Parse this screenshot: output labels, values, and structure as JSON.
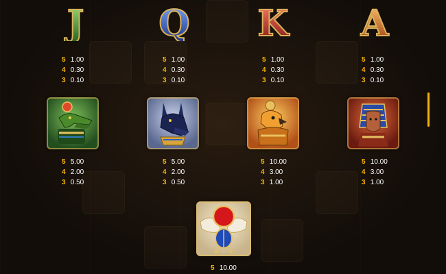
{
  "letters": [
    {
      "symbol": "J",
      "color": "#3f9a3a"
    },
    {
      "symbol": "Q",
      "color": "#2e4fb0"
    },
    {
      "symbol": "K",
      "color": "#c0332a"
    },
    {
      "symbol": "A",
      "color": "#d7701f"
    }
  ],
  "paytable_row1": [
    [
      {
        "count": "5",
        "value": "1.00"
      },
      {
        "count": "4",
        "value": "0.30"
      },
      {
        "count": "3",
        "value": "0.10"
      }
    ],
    [
      {
        "count": "5",
        "value": "1.00"
      },
      {
        "count": "4",
        "value": "0.30"
      },
      {
        "count": "3",
        "value": "0.10"
      }
    ],
    [
      {
        "count": "5",
        "value": "1.00"
      },
      {
        "count": "4",
        "value": "0.30"
      },
      {
        "count": "3",
        "value": "0.10"
      }
    ],
    [
      {
        "count": "5",
        "value": "1.00"
      },
      {
        "count": "4",
        "value": "0.30"
      },
      {
        "count": "3",
        "value": "0.10"
      }
    ]
  ],
  "gods": [
    {
      "icon": "crocodile-god-icon",
      "bg": "#2f6a30"
    },
    {
      "icon": "anubis-icon",
      "bg": "#4a5a8a"
    },
    {
      "icon": "horus-falcon-icon",
      "bg": "#b8581a"
    },
    {
      "icon": "pharaoh-icon",
      "bg": "#9a2e1e"
    }
  ],
  "paytable_row2": [
    [
      {
        "count": "5",
        "value": "5.00"
      },
      {
        "count": "4",
        "value": "2.00"
      },
      {
        "count": "3",
        "value": "0.50"
      }
    ],
    [
      {
        "count": "5",
        "value": "5.00"
      },
      {
        "count": "4",
        "value": "2.00"
      },
      {
        "count": "3",
        "value": "0.50"
      }
    ],
    [
      {
        "count": "5",
        "value": "10.00"
      },
      {
        "count": "4",
        "value": "3.00"
      },
      {
        "count": "3",
        "value": "1.00"
      }
    ],
    [
      {
        "count": "5",
        "value": "10.00"
      },
      {
        "count": "4",
        "value": "3.00"
      },
      {
        "count": "3",
        "value": "1.00"
      }
    ]
  ],
  "scarab": {
    "icon": "scarab-icon"
  },
  "paytable_row3": [
    {
      "count": "5",
      "value": "10.00"
    }
  ],
  "accent": "#f5b400"
}
